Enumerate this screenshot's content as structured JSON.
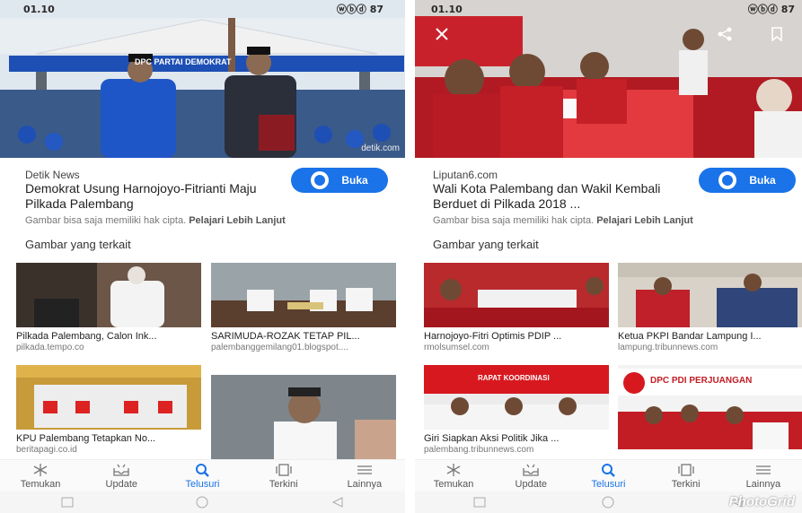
{
  "left": {
    "status_time": "01.10",
    "status_right": "ⓦⓑⓓ 87",
    "hero_banner": "DPC PARTAI DEMOKRAT",
    "hero_watermark": "detik.com",
    "source": "Detik News",
    "headline": "Demokrat Usung Harnojoyo-Fitrianti Maju Pilkada Palembang",
    "open_label": "Buka",
    "copyright_text": "Gambar bisa saja memiliki hak cipta.",
    "copyright_link": "Pelajari Lebih Lanjut",
    "related_title": "Gambar yang terkait",
    "thumbs": [
      {
        "title": "Pilkada Palembang, Calon Ink...",
        "domain": "pilkada.tempo.co"
      },
      {
        "title": "SARIMUDA-ROZAK TETAP PIL...",
        "domain": "palembanggemilang01.blogspot...."
      },
      {
        "title": "KPU Palembang Tetapkan No...",
        "domain": "beritapagi.co.id"
      },
      {
        "title": "",
        "domain": ""
      }
    ],
    "nav": [
      {
        "label": "Temukan",
        "icon": "asterisk-icon"
      },
      {
        "label": "Update",
        "icon": "inbox-icon"
      },
      {
        "label": "Telusuri",
        "icon": "search-icon"
      },
      {
        "label": "Terkini",
        "icon": "cards-icon"
      },
      {
        "label": "Lainnya",
        "icon": "menu-icon"
      }
    ]
  },
  "right": {
    "status_time": "01.10",
    "status_right": "ⓦⓑⓓ 87",
    "source": "Liputan6.com",
    "headline": "Wali Kota Palembang dan Wakil Kembali Berduet di Pilkada 2018 ...",
    "open_label": "Buka",
    "copyright_text": "Gambar bisa saja memiliki hak cipta.",
    "copyright_link": "Pelajari Lebih Lanjut",
    "related_title": "Gambar yang terkait",
    "thumbs": [
      {
        "title": "Harnojoyo-Fitri Optimis PDIP ...",
        "domain": "rmolsumsel.com"
      },
      {
        "title": "Ketua PKPI Bandar Lampung I...",
        "domain": "lampung.tribunnews.com"
      },
      {
        "title": "Giri Siapkan Aksi Politik Jika ...",
        "domain": "palembang.tribunnews.com"
      },
      {
        "title": "",
        "domain": ""
      }
    ],
    "thumb_banner_3": "RAPAT KOORDINASI",
    "thumb_banner_4": "DPC PDI PERJUANGAN",
    "nav": [
      {
        "label": "Temukan",
        "icon": "asterisk-icon"
      },
      {
        "label": "Update",
        "icon": "inbox-icon"
      },
      {
        "label": "Telusuri",
        "icon": "search-icon"
      },
      {
        "label": "Terkini",
        "icon": "cards-icon"
      },
      {
        "label": "Lainnya",
        "icon": "menu-icon"
      }
    ],
    "watermark": "PhotoGrid"
  },
  "colors": {
    "accent": "#1a73e8",
    "democrat_blue": "#1e4fb4",
    "pdip_red": "#d7191f"
  }
}
